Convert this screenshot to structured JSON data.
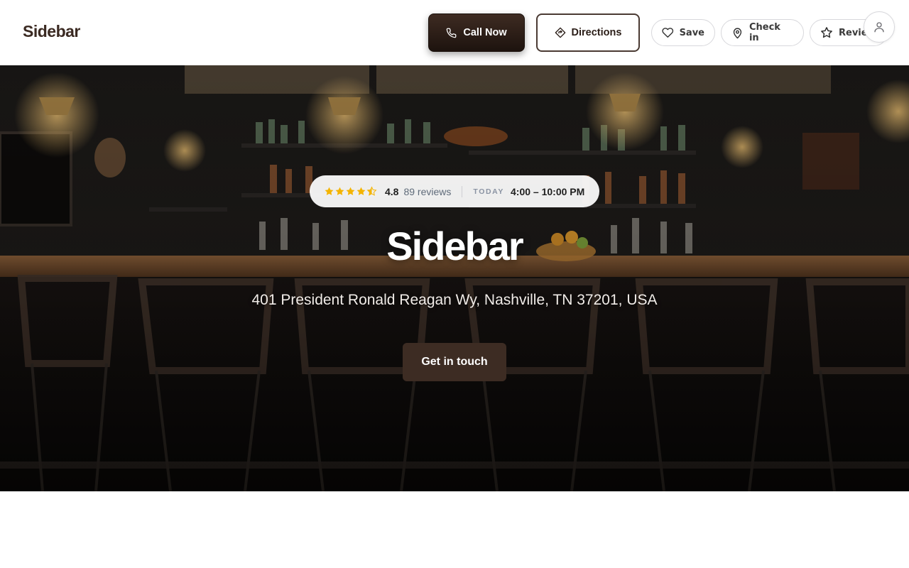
{
  "header": {
    "brand": "Sidebar",
    "call_label": "Call Now",
    "directions_label": "Directions",
    "save_label": "Save",
    "checkin_label": "Check in",
    "review_label": "Review"
  },
  "hero": {
    "rating": {
      "stars": 4.5,
      "value": "4.8",
      "count": "89 reviews",
      "today_label": "TODAY",
      "hours": "4:00 – 10:00 PM"
    },
    "title": "Sidebar",
    "address": "401 President Ronald Reagan Wy, Nashville, TN 37201, USA",
    "cta_label": "Get in touch"
  },
  "colors": {
    "brand": "#3b2a22",
    "primary_button": "#3d2c23",
    "star": "#f4b400"
  },
  "icons": {
    "call": "phone-icon",
    "directions": "directions-icon",
    "save": "heart-icon",
    "checkin": "map-pin-icon",
    "review": "star-icon",
    "account": "user-icon"
  }
}
